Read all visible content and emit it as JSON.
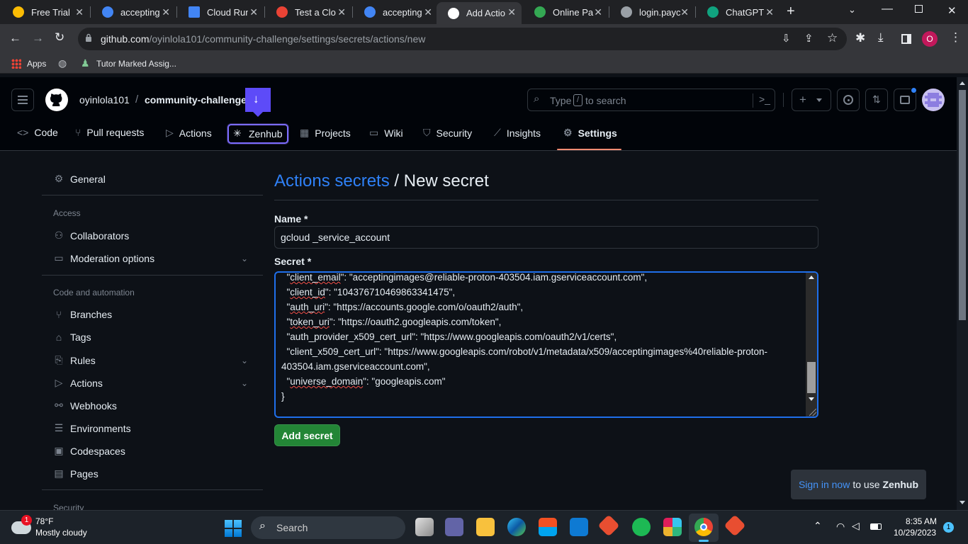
{
  "browser": {
    "tabs": [
      {
        "title": "Free Trial",
        "favicon_color": "#fbbc04"
      },
      {
        "title": "accepting",
        "favicon_color": "#4285f4"
      },
      {
        "title": "Cloud Run",
        "favicon_color": "#4285f4"
      },
      {
        "title": "Test a Clo",
        "favicon_color": "#ea4335"
      },
      {
        "title": "accepting",
        "favicon_color": "#4285f4"
      },
      {
        "title": "Add Actio",
        "favicon_color": "#ffffff"
      },
      {
        "title": "Online Pa",
        "favicon_color": "#34a853"
      },
      {
        "title": "login.payc",
        "favicon_color": "#9aa0a6"
      },
      {
        "title": "ChatGPT",
        "favicon_color": "#10a37f"
      }
    ],
    "new_tab_icon": "plus-icon",
    "url_host": "github.com",
    "url_path": "/oyinlola101/community-challenge/settings/secrets/actions/new",
    "profile_initial": "O",
    "bookmarks": [
      {
        "label": "Apps",
        "icon": "apps-grid-icon"
      },
      {
        "label": "",
        "icon": "globe-icon"
      },
      {
        "label": "Tutor Marked Assig...",
        "icon": "tutor-icon"
      }
    ]
  },
  "github": {
    "owner": "oyinlola101",
    "separator": "/",
    "repo": "community-challenge",
    "search_placeholder_pre": "Type",
    "search_key": "/",
    "search_placeholder_post": "to search",
    "nav": [
      {
        "label": "Code",
        "icon": "code-icon"
      },
      {
        "label": "Pull requests",
        "icon": "pull-request-icon"
      },
      {
        "label": "Actions",
        "icon": "play-icon"
      },
      {
        "label": "Zenhub",
        "icon": "zenhub-icon"
      },
      {
        "label": "Projects",
        "icon": "table-icon"
      },
      {
        "label": "Wiki",
        "icon": "book-icon"
      },
      {
        "label": "Security",
        "icon": "shield-icon"
      },
      {
        "label": "Insights",
        "icon": "graph-icon"
      },
      {
        "label": "Settings",
        "icon": "gear-icon"
      }
    ],
    "active_nav": "Settings",
    "accent_color": "#fd8c73"
  },
  "sidebar": {
    "general": "General",
    "access_heading": "Access",
    "collaborators": "Collaborators",
    "moderation": "Moderation options",
    "code_heading": "Code and automation",
    "branches": "Branches",
    "tags": "Tags",
    "rules": "Rules",
    "actions": "Actions",
    "webhooks": "Webhooks",
    "environments": "Environments",
    "codespaces": "Codespaces",
    "pages": "Pages",
    "security_heading": "Security"
  },
  "form": {
    "breadcrumb_link": "Actions secrets",
    "breadcrumb_sep": "/",
    "breadcrumb_current": "New secret",
    "name_label": "Name *",
    "name_value": "gcloud _service_account",
    "secret_label": "Secret *",
    "secret_lines": [
      {
        "key": "client_email",
        "rest": ": \"acceptingimages@reliable-proton-403504.iam.gserviceaccount.com\","
      },
      {
        "key": "client_id",
        "rest": ": \"104376710469863341475\","
      },
      {
        "key": "auth_uri",
        "rest": ": \"https://accounts.google.com/o/oauth2/auth\","
      },
      {
        "key": "token_uri",
        "rest": ": \"https://oauth2.googleapis.com/token\","
      },
      {
        "key": "auth_provider_x509_cert_url",
        "rest": ": \"https://www.googleapis.com/oauth2/v1/certs\","
      },
      {
        "key": "client_x509_cert_url",
        "rest": ": \"https://www.googleapis.com/robot/v1/metadata/x509/acceptingimages%40reliable-proton-"
      },
      {
        "key": "",
        "rest": "403504.iam.gserviceaccount.com\","
      },
      {
        "key": "universe_domain",
        "rest": ": \"googleapis.com\""
      },
      {
        "key": "",
        "rest": "}"
      }
    ],
    "submit_label": "Add secret"
  },
  "zenhub_toast": {
    "link": "Sign in now",
    "text": "to use",
    "brand": "Zenhub"
  },
  "taskbar": {
    "weather_temp": "78°F",
    "weather_desc": "Mostly cloudy",
    "weather_badge": "1",
    "search_label": "Search",
    "time": "8:35 AM",
    "date": "10/29/2023",
    "notif_count": "1"
  }
}
